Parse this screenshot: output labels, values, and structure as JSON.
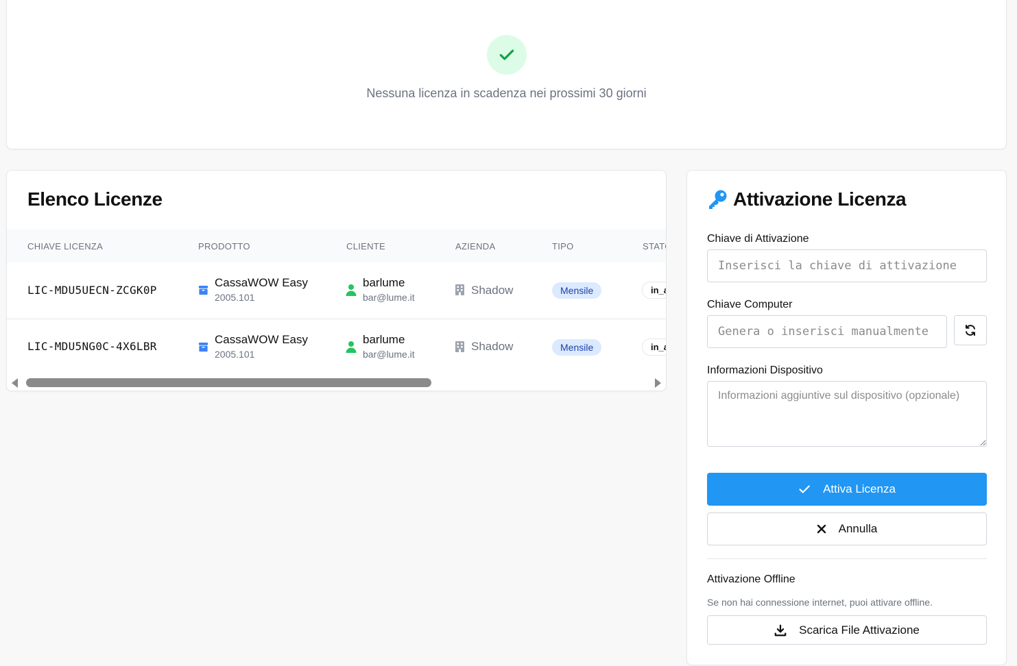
{
  "expiring": {
    "message": "Nessuna licenza in scadenza nei prossimi 30 giorni",
    "icon": "check-icon",
    "color": "#16a34a"
  },
  "licenses": {
    "title": "Elenco Licenze",
    "columns": [
      "CHIAVE LICENZA",
      "PRODOTTO",
      "CLIENTE",
      "AZIENDA",
      "TIPO",
      "STATO"
    ],
    "rows": [
      {
        "key": "LIC-MDU5UECN-ZCGK0P",
        "product": "CassaWOW Easy",
        "version": "2005.101",
        "client_name": "barlume",
        "client_email": "bar@lume.it",
        "company": "Shadow",
        "type": "Mensile",
        "status": "in_attesa"
      },
      {
        "key": "LIC-MDU5NG0C-4X6LBR",
        "product": "CassaWOW Easy",
        "version": "2005.101",
        "client_name": "barlume",
        "client_email": "bar@lume.it",
        "company": "Shadow",
        "type": "Mensile",
        "status": "in_attesa"
      }
    ]
  },
  "activation": {
    "title": "Attivazione Licenza",
    "activation_key_label": "Chiave di Attivazione",
    "activation_key_placeholder": "Inserisci la chiave di attivazione",
    "activation_key_value": "",
    "computer_key_label": "Chiave Computer",
    "computer_key_placeholder": "Genera o inserisci manualmente",
    "computer_key_value": "",
    "device_info_label": "Informazioni Dispositivo",
    "device_info_placeholder": "Informazioni aggiuntive sul dispositivo (opzionale)",
    "device_info_value": "",
    "activate_label": "Attiva Licenza",
    "cancel_label": "Annulla",
    "offline_title": "Attivazione Offline",
    "offline_hint": "Se non hai connessione internet, puoi attivare offline.",
    "download_label": "Scarica File Attivazione",
    "accent": "#2196f3"
  }
}
